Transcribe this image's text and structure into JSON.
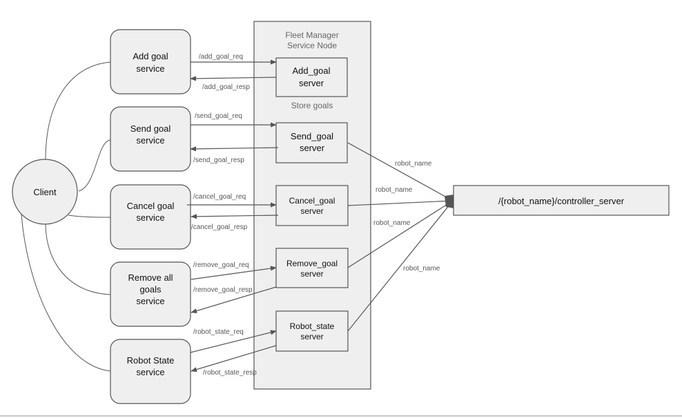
{
  "diagram": {
    "client": {
      "label": "Client"
    },
    "group": {
      "title_lines": [
        "Fleet Manager",
        "Service Node"
      ],
      "note": "Store goals"
    },
    "services": [
      {
        "id": "add",
        "lines": [
          "Add goal",
          "service"
        ]
      },
      {
        "id": "send",
        "lines": [
          "Send goal",
          "service"
        ]
      },
      {
        "id": "cancel",
        "lines": [
          "Cancel goal",
          "service"
        ]
      },
      {
        "id": "remove",
        "lines": [
          "Remove all",
          "goals",
          "service"
        ]
      },
      {
        "id": "state",
        "lines": [
          "Robot State",
          "service"
        ]
      }
    ],
    "servers": [
      {
        "id": "add",
        "lines": [
          "Add_goal",
          "server"
        ]
      },
      {
        "id": "send",
        "lines": [
          "Send_goal",
          "server"
        ]
      },
      {
        "id": "cancel",
        "lines": [
          "Cancel_goal",
          "server"
        ]
      },
      {
        "id": "remove",
        "lines": [
          "Remove_goal",
          "server"
        ]
      },
      {
        "id": "state",
        "lines": [
          "Robot_state",
          "server"
        ]
      }
    ],
    "requests": [
      "/add_goal_req",
      "/send_goal_req",
      "/cancel_goal_req",
      "/remove_goal_req",
      "/robot_state_req"
    ],
    "responses": [
      "/add_goal_resp",
      "/send_goal_resp",
      "/cancel_goal_resp",
      "/remove_goal_resp",
      "/robot_state_resp"
    ],
    "controller": {
      "label": "/{robot_name}/controller_server"
    },
    "controller_edges": [
      "robot_name",
      "robot_name",
      "robot_name",
      "robot_name"
    ],
    "colors": {
      "node_fill": "#efefef",
      "stroke": "#555555",
      "group_fill": "#efefef",
      "edge": "#555555"
    }
  }
}
